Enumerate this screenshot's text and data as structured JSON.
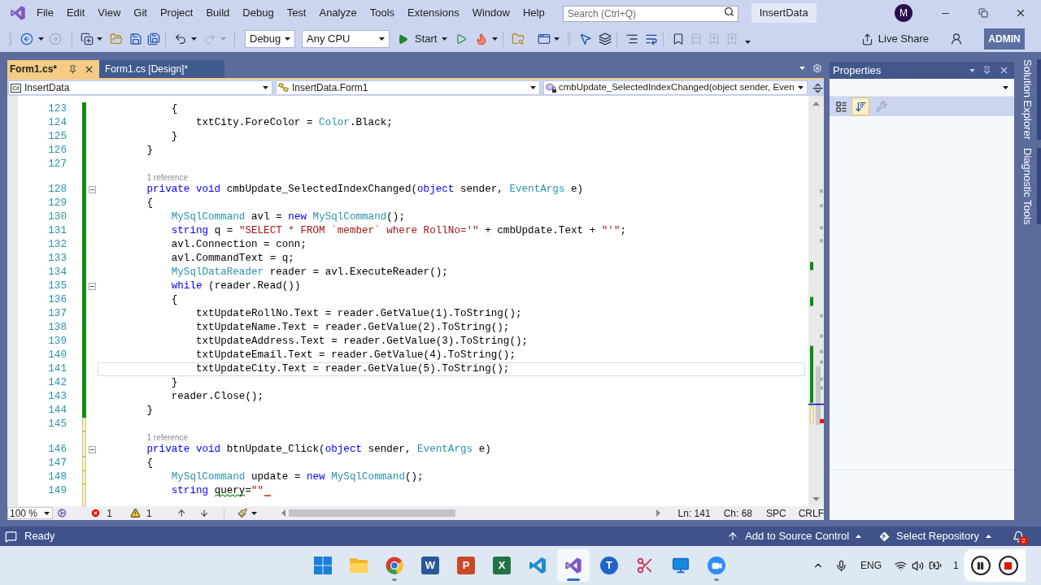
{
  "menu_bar": {
    "items": [
      "File",
      "Edit",
      "View",
      "Git",
      "Project",
      "Build",
      "Debug",
      "Test",
      "Analyze",
      "Tools",
      "Extensions",
      "Window",
      "Help"
    ],
    "search": {
      "placeholder": "Search (Ctrl+Q)"
    },
    "solution": "InsertData",
    "account_initial": "M"
  },
  "toolbar": {
    "history": [
      {
        "kind": "back",
        "disabled": false
      },
      {
        "kind": "forward",
        "disabled": true
      }
    ],
    "undo_redo": [
      {
        "kind": "undo",
        "disabled": false
      },
      {
        "kind": "redo",
        "disabled": true
      }
    ],
    "configuration": "Debug",
    "platform": "Any CPU",
    "start": "Start",
    "bookmarks": [
      {
        "kind": "toggle",
        "disabled": false
      },
      {
        "kind": "previous",
        "disabled": true
      },
      {
        "kind": "next",
        "disabled": true
      },
      {
        "kind": "clear",
        "disabled": true
      }
    ],
    "live_share": "Live Share",
    "admin": "ADMIN"
  },
  "document_tabs": [
    {
      "label": "Form1.cs*",
      "selected": true
    },
    {
      "label": "Form1.cs [Design]*",
      "selected": false
    }
  ],
  "navigation_bar": {
    "language": "C#",
    "project": "InsertData",
    "type": "InsertData.Form1",
    "member": "cmbUpdate_SelectedIndexChanged(object sender, Even"
  },
  "editor": {
    "lines": [
      {
        "number": "123",
        "unsaved": false,
        "current": false,
        "segments": [
          {
            "text": "            {",
            "kind": "plain"
          }
        ]
      },
      {
        "number": "124",
        "unsaved": false,
        "current": false,
        "segments": [
          {
            "text": "                txtCity.ForeColor = ",
            "kind": "plain"
          },
          {
            "text": "Color",
            "kind": "type"
          },
          {
            "text": ".Black;",
            "kind": "plain"
          }
        ]
      },
      {
        "number": "125",
        "unsaved": false,
        "current": false,
        "segments": [
          {
            "text": "            }",
            "kind": "plain"
          }
        ]
      },
      {
        "number": "126",
        "unsaved": false,
        "current": false,
        "segments": [
          {
            "text": "        }",
            "kind": "plain"
          }
        ]
      },
      {
        "number": "127",
        "unsaved": false,
        "current": false
      },
      {
        "number": "128",
        "unsaved": false,
        "current": false,
        "reference": "1 reference",
        "outline": {
          "expanded": true
        },
        "segments": [
          {
            "text": "        private void",
            "kind": "keyword"
          },
          {
            "text": " cmbUpdate_SelectedIndexChanged(",
            "kind": "plain"
          },
          {
            "text": "object",
            "kind": "keyword"
          },
          {
            "text": " sender, ",
            "kind": "plain"
          },
          {
            "text": "EventArgs",
            "kind": "type"
          },
          {
            "text": " e)",
            "kind": "plain"
          }
        ]
      },
      {
        "number": "129",
        "unsaved": false,
        "current": false,
        "segments": [
          {
            "text": "        {",
            "kind": "plain"
          }
        ]
      },
      {
        "number": "130",
        "unsaved": false,
        "current": false,
        "segments": [
          {
            "text": "            MySqlCommand",
            "kind": "type"
          },
          {
            "text": " avl = ",
            "kind": "plain"
          },
          {
            "text": "new",
            "kind": "keyword"
          },
          {
            "text": " MySqlCommand",
            "kind": "type"
          },
          {
            "text": "();",
            "kind": "plain"
          }
        ]
      },
      {
        "number": "131",
        "unsaved": false,
        "current": false,
        "segments": [
          {
            "text": "            string",
            "kind": "keyword"
          },
          {
            "text": " q = ",
            "kind": "plain"
          },
          {
            "text": "\"SELECT * FROM `member` where RollNo='\"",
            "kind": "string"
          },
          {
            "text": " + cmbUpdate.Text + ",
            "kind": "plain"
          },
          {
            "text": "\"'\"",
            "kind": "string"
          },
          {
            "text": ";",
            "kind": "plain"
          }
        ]
      },
      {
        "number": "132",
        "unsaved": false,
        "current": false,
        "segments": [
          {
            "text": "            avl.Connection = conn;",
            "kind": "plain"
          }
        ]
      },
      {
        "number": "133",
        "unsaved": false,
        "current": false,
        "segments": [
          {
            "text": "            avl.CommandText = q;",
            "kind": "plain"
          }
        ]
      },
      {
        "number": "134",
        "unsaved": false,
        "current": false,
        "segments": [
          {
            "text": "            MySqlDataReader",
            "kind": "type"
          },
          {
            "text": " reader = avl.ExecuteReader();",
            "kind": "plain"
          }
        ]
      },
      {
        "number": "135",
        "unsaved": false,
        "current": false,
        "outline": {
          "expanded": true
        },
        "segments": [
          {
            "text": "            while",
            "kind": "keyword"
          },
          {
            "text": " (reader.Read())",
            "kind": "plain"
          }
        ]
      },
      {
        "number": "136",
        "unsaved": false,
        "current": false,
        "segments": [
          {
            "text": "            {",
            "kind": "plain"
          }
        ]
      },
      {
        "number": "137",
        "unsaved": false,
        "current": false,
        "segments": [
          {
            "text": "                txtUpdateRollNo.Text = reader.GetValue(1).ToString();",
            "kind": "plain"
          }
        ]
      },
      {
        "number": "138",
        "unsaved": false,
        "current": false,
        "segments": [
          {
            "text": "                txtUpdateName.Text = reader.GetValue(2).ToString();",
            "kind": "plain"
          }
        ]
      },
      {
        "number": "139",
        "unsaved": false,
        "current": false,
        "segments": [
          {
            "text": "                txtUpdateAddress.Text = reader.GetValue(3).ToString();",
            "kind": "plain"
          }
        ]
      },
      {
        "number": "140",
        "unsaved": false,
        "current": false,
        "segments": [
          {
            "text": "                txtUpdateEmail.Text = reader.GetValue(4).ToString();",
            "kind": "plain"
          }
        ]
      },
      {
        "number": "141",
        "unsaved": false,
        "current": true,
        "segments": [
          {
            "text": "                txtUpdateCity.Text = reader.GetValue(5).ToString();",
            "kind": "plain"
          }
        ]
      },
      {
        "number": "142",
        "unsaved": false,
        "current": false,
        "segments": [
          {
            "text": "            }",
            "kind": "plain"
          }
        ]
      },
      {
        "number": "143",
        "unsaved": false,
        "current": false,
        "segments": [
          {
            "text": "            reader.Close();",
            "kind": "plain"
          }
        ]
      },
      {
        "number": "144",
        "unsaved": false,
        "current": false,
        "segments": [
          {
            "text": "        }",
            "kind": "plain"
          }
        ]
      },
      {
        "number": "145",
        "unsaved": true,
        "current": false
      },
      {
        "number": "146",
        "unsaved": true,
        "current": false,
        "reference": "1 reference",
        "outline": {
          "expanded": true
        },
        "segments": [
          {
            "text": "        private void",
            "kind": "keyword"
          },
          {
            "text": " btnUpdate_Click(",
            "kind": "plain"
          },
          {
            "text": "object",
            "kind": "keyword"
          },
          {
            "text": " sender, ",
            "kind": "plain"
          },
          {
            "text": "EventArgs",
            "kind": "type"
          },
          {
            "text": " e)",
            "kind": "plain"
          }
        ]
      },
      {
        "number": "147",
        "unsaved": true,
        "current": false,
        "segments": [
          {
            "text": "        {",
            "kind": "plain"
          }
        ]
      },
      {
        "number": "148",
        "unsaved": true,
        "current": false,
        "segments": [
          {
            "text": "            MySqlCommand",
            "kind": "type"
          },
          {
            "text": " update = ",
            "kind": "plain"
          },
          {
            "text": "new",
            "kind": "keyword"
          },
          {
            "text": " MySqlCommand",
            "kind": "type"
          },
          {
            "text": "();",
            "kind": "plain"
          }
        ]
      },
      {
        "number": "149",
        "unsaved": true,
        "current": false,
        "error_squiggle": true,
        "segments": [
          {
            "text": "            string ",
            "kind": "keyword"
          },
          {
            "text": "query",
            "kind": "plain",
            "warning": true
          },
          {
            "text": "=",
            "kind": "plain"
          },
          {
            "text": "\"\"",
            "kind": "string"
          }
        ]
      }
    ],
    "status": {
      "zoom": "100 %",
      "errors": "1",
      "warnings": "1",
      "line": "Ln: 141",
      "column": "Ch: 68",
      "indent": "SPC",
      "line_ending": "CRLF"
    }
  },
  "properties": {
    "title": "Properties",
    "views": [
      {
        "kind": "categorized",
        "selected": false
      },
      {
        "kind": "alphabetical",
        "selected": true
      }
    ],
    "property_pages": {
      "disabled": true
    }
  },
  "side_tabs": [
    "Solution Explorer",
    "Diagnostic Tools"
  ],
  "status_bar": {
    "message": "Ready",
    "source_control": "Add to Source Control",
    "repository": "Select Repository",
    "notifications": "2"
  },
  "taskbar": {
    "apps": [
      {
        "kind": "start",
        "running": false,
        "selected": false
      },
      {
        "kind": "explorer",
        "running": false,
        "selected": false
      },
      {
        "kind": "browser",
        "running": true,
        "selected": false
      },
      {
        "kind": "word",
        "label": "W",
        "running": false,
        "selected": false
      },
      {
        "kind": "slides",
        "label": "P",
        "running": false,
        "selected": false
      },
      {
        "kind": "sheets",
        "label": "X",
        "running": false,
        "selected": false
      },
      {
        "kind": "code",
        "running": false,
        "selected": false
      },
      {
        "kind": "studio",
        "running": true,
        "selected": true
      },
      {
        "kind": "badge",
        "label": "T",
        "running": false,
        "selected": false
      },
      {
        "kind": "snip",
        "running": false,
        "selected": false
      },
      {
        "kind": "monitor",
        "running": false,
        "selected": false
      },
      {
        "kind": "camera",
        "running": true,
        "selected": false
      }
    ],
    "language": "ENG",
    "clock": "1"
  }
}
